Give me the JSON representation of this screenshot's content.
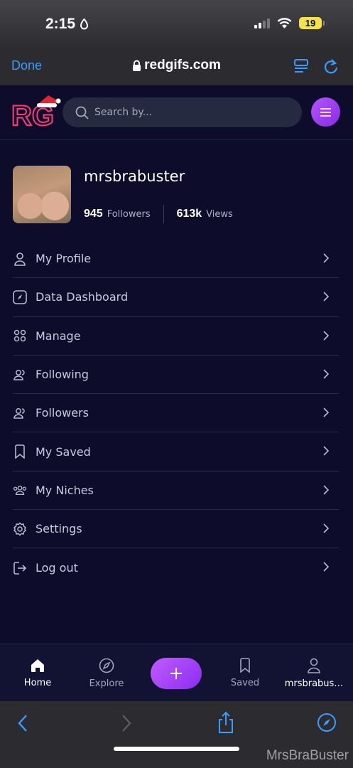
{
  "status_bar": {
    "time": "2:15",
    "battery": "19"
  },
  "browser": {
    "done_label": "Done",
    "url": "redgifs.com"
  },
  "header": {
    "logo_text": "RG",
    "search_placeholder": "Search by..."
  },
  "profile": {
    "username": "mrsbrabuster",
    "followers_count": "945",
    "followers_label": "Followers",
    "views_count": "613k",
    "views_label": "Views"
  },
  "menu": {
    "items": [
      {
        "label": "My Profile",
        "icon": "user-icon"
      },
      {
        "label": "Data Dashboard",
        "icon": "dashboard-icon"
      },
      {
        "label": "Manage",
        "icon": "grid-icon"
      },
      {
        "label": "Following",
        "icon": "following-icon"
      },
      {
        "label": "Followers",
        "icon": "followers-icon"
      },
      {
        "label": "My Saved",
        "icon": "bookmark-icon"
      },
      {
        "label": "My Niches",
        "icon": "group-icon"
      },
      {
        "label": "Settings",
        "icon": "gear-icon"
      },
      {
        "label": "Log out",
        "icon": "logout-icon"
      }
    ]
  },
  "tabs": {
    "home": "Home",
    "explore": "Explore",
    "saved": "Saved",
    "profile": "mrsbrabus…"
  },
  "watermark": "MrsBraBuster",
  "colors": {
    "accent": "#a645f5",
    "background": "#0d0d2b",
    "link": "#3b9cff"
  }
}
